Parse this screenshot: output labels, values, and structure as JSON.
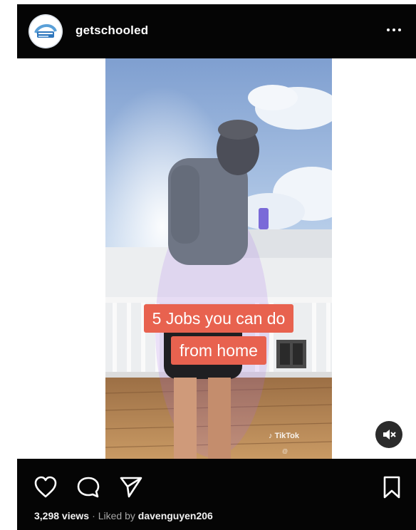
{
  "post": {
    "username": "getschooled",
    "more_icon": "more-horizontal-icon",
    "video_caption_line1": "5 Jobs you can do",
    "video_caption_line2": "from home",
    "watermark": "TikTok",
    "watermark_handle": "@",
    "mute_icon": "speaker-muted-icon"
  },
  "actions": {
    "like_icon": "heart-icon",
    "comment_icon": "comment-icon",
    "share_icon": "send-icon",
    "save_icon": "bookmark-icon"
  },
  "stats": {
    "views": "3,298 views",
    "separator": "·",
    "liked_by_prefix": "Liked by",
    "liked_by_user": "davenguyen206"
  },
  "colors": {
    "bar_background": "#050505",
    "caption_background": "#e8624f",
    "text_white": "#ffffff"
  }
}
